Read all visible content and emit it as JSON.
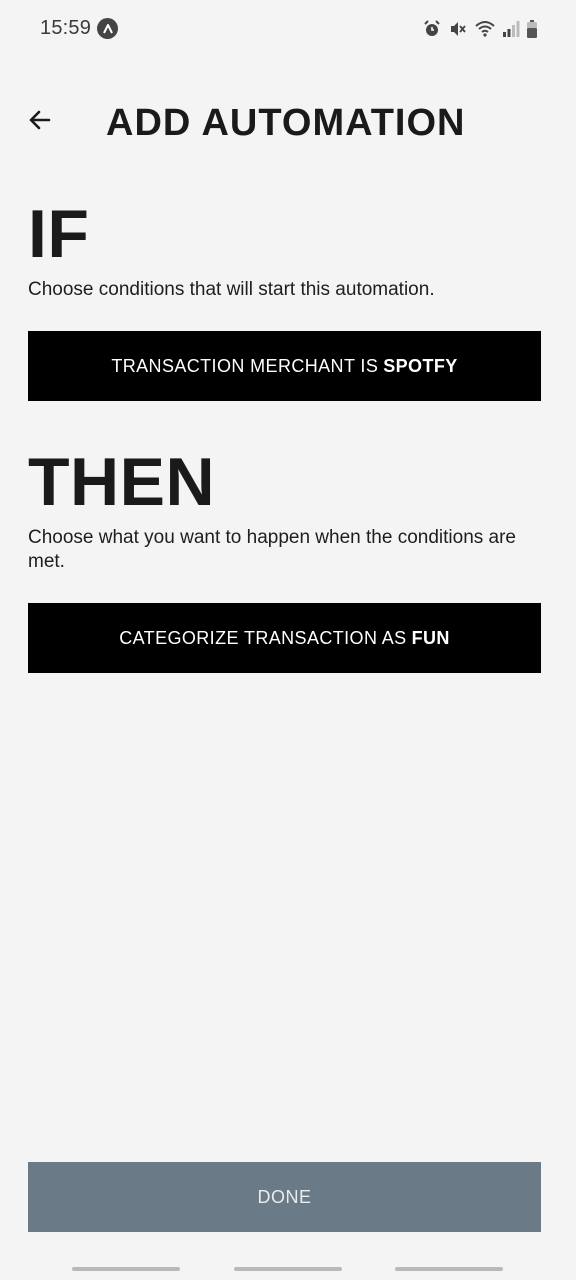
{
  "status_bar": {
    "time": "15:59",
    "icons": [
      "app-notification-icon",
      "alarm-icon",
      "mute-icon",
      "wifi-icon",
      "signal-icon",
      "battery-icon"
    ]
  },
  "header": {
    "title": "ADD AUTOMATION",
    "back_icon": "arrow-left-icon"
  },
  "if_section": {
    "heading": "IF",
    "description": "Choose conditions that will start this automation.",
    "condition": {
      "prefix": "TRANSACTION MERCHANT IS",
      "value": "SPOTFY"
    }
  },
  "then_section": {
    "heading": "THEN",
    "description": "Choose what you want to happen when the conditions are met.",
    "action": {
      "prefix": "CATEGORIZE TRANSACTION AS",
      "value": "FUN"
    }
  },
  "done_button": {
    "label": "DONE"
  },
  "colors": {
    "background": "#f4f4f4",
    "rule_box": "#000000",
    "done_button": "#6b7a87",
    "text": "#1a1a1a"
  }
}
